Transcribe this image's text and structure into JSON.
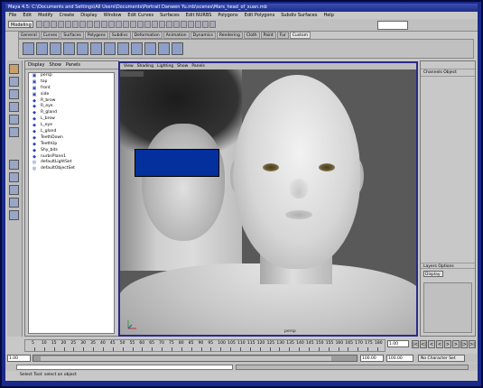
{
  "window": {
    "title": "Maya 4.5: C:\\Documents and Settings\\All Users\\Documents\\Portrait Danwen Yu.mb\\scenes\\Mars_head_of_xuan.mb"
  },
  "menubar": [
    "File",
    "Edit",
    "Modify",
    "Create",
    "Display",
    "Window",
    "Edit Curves",
    "Surfaces",
    "Edit NURBS",
    "Polygons",
    "Edit Polygons",
    "Subdiv Surfaces",
    "Help"
  ],
  "status_line": {
    "mode": "Modeling"
  },
  "shelf_tabs": [
    "General",
    "Curves",
    "Surfaces",
    "Polygons",
    "Subdivs",
    "Deformation",
    "Animation",
    "Dynamics",
    "Rendering",
    "Cloth",
    "Paint",
    "Fur",
    "Custom"
  ],
  "shelf_active": "Custom",
  "outliner": {
    "menu": [
      "Display",
      "Show",
      "Panels"
    ],
    "items": [
      {
        "label": "persp",
        "icon": "camera-icon"
      },
      {
        "label": "top",
        "icon": "camera-icon"
      },
      {
        "label": "front",
        "icon": "camera-icon"
      },
      {
        "label": "side",
        "icon": "camera-icon"
      },
      {
        "label": "R_brow",
        "icon": "nurbs-icon"
      },
      {
        "label": "R_eye",
        "icon": "nurbs-icon"
      },
      {
        "label": "R_gland",
        "icon": "nurbs-icon"
      },
      {
        "label": "L_brow",
        "icon": "nurbs-icon"
      },
      {
        "label": "L_eye",
        "icon": "nurbs-icon"
      },
      {
        "label": "L_gland",
        "icon": "nurbs-icon"
      },
      {
        "label": "TeethDown",
        "icon": "nurbs-icon"
      },
      {
        "label": "TeethUp",
        "icon": "nurbs-icon"
      },
      {
        "label": "Shy_bits",
        "icon": "nurbs-icon"
      },
      {
        "label": "nurbsPlane1",
        "icon": "nurbs-icon"
      },
      {
        "label": "defaultLightSet",
        "icon": "set-icon"
      },
      {
        "label": "defaultObjectSet",
        "icon": "set-icon"
      }
    ]
  },
  "viewport": {
    "menu": [
      "View",
      "Shading",
      "Lighting",
      "Show",
      "Panels"
    ],
    "camera_label": "persp"
  },
  "channel_box": {
    "top_menu": [
      "Channels",
      "Object"
    ],
    "layers_menu": [
      "Layers",
      "Options"
    ],
    "layers_dropdown": "Display"
  },
  "timeline": {
    "ticks": [
      "5",
      "10",
      "15",
      "20",
      "25",
      "30",
      "35",
      "40",
      "45",
      "50",
      "55",
      "60",
      "65",
      "70",
      "75",
      "80",
      "85",
      "90",
      "95",
      "100",
      "105",
      "110",
      "115",
      "120",
      "125",
      "130",
      "135",
      "140",
      "145",
      "150",
      "155",
      "160",
      "165",
      "170",
      "175",
      "180"
    ],
    "current_frame": "1.00",
    "playback_buttons": [
      "|<",
      "<|",
      "<",
      "<",
      ">",
      ">",
      "|>",
      ">|"
    ]
  },
  "range": {
    "start": "1.00",
    "start_inner": "1.00",
    "end_inner": "100.00",
    "end": "100.00",
    "character_set": "No Character Set"
  },
  "help_line": "Select Tool: select an object"
}
